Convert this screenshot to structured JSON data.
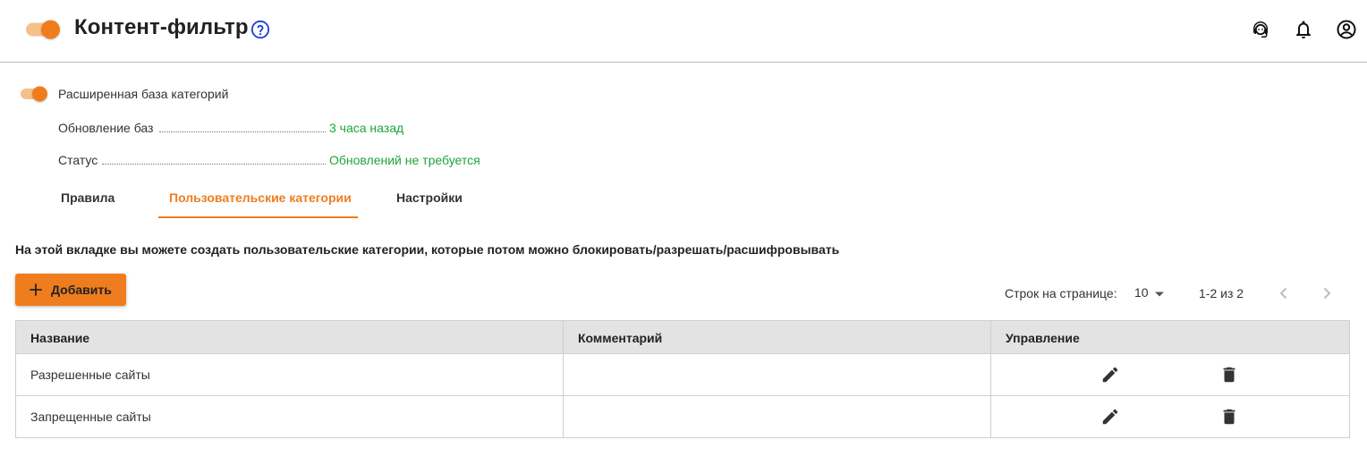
{
  "header": {
    "title": "Контент-фильтр",
    "enabled": true,
    "icons": [
      "help-icon",
      "support-agent-icon",
      "bell-icon",
      "account-icon"
    ]
  },
  "extended_db": {
    "label": "Расширенная база категорий",
    "enabled": true
  },
  "info": [
    {
      "key": "Обновление баз",
      "value": "3 часа назад"
    },
    {
      "key": "Статус",
      "value": "Обновлений не требуется"
    }
  ],
  "tabs": [
    {
      "label": "Правила",
      "active": false
    },
    {
      "label": "Пользовательские категории",
      "active": true
    },
    {
      "label": "Настройки",
      "active": false
    }
  ],
  "description": "На этой вкладке вы можете создать пользовательские категории, которые потом можно блокировать/разрешать/расшифровывать",
  "add_button": {
    "label": "Добавить"
  },
  "pagination": {
    "rows_label": "Строк на странице:",
    "rows_value": "10",
    "range": "1-2 из 2"
  },
  "table": {
    "columns": [
      "Название",
      "Комментарий",
      "Управление"
    ],
    "rows": [
      {
        "name": "Разрешенные сайты",
        "comment": ""
      },
      {
        "name": "Запрещенные сайты",
        "comment": ""
      }
    ]
  },
  "colors": {
    "accent": "#ef7d1e",
    "toggle_track": "#f5c08a",
    "status_green": "#1fa33a",
    "help_blue": "#1e3fd6",
    "table_header_bg": "#e3e3e3"
  }
}
